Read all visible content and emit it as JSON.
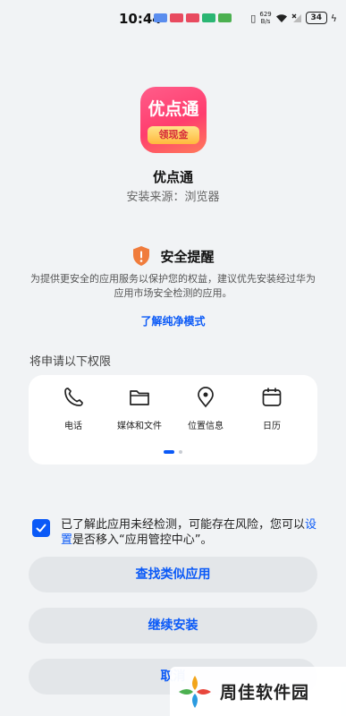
{
  "status_bar": {
    "time": "10:44",
    "net_speed_value": "629",
    "net_speed_unit": "B/s",
    "battery": "34"
  },
  "app": {
    "icon_title": "优点通",
    "icon_ribbon": "领现金",
    "name": "优点通",
    "source": "安装来源：浏览器"
  },
  "security": {
    "title": "安全提醒",
    "body": "为提供更安全的应用服务以保护您的权益，建议优先安装经过华为应用市场安全检测的应用。",
    "link": "了解纯净模式",
    "accent": "#f07c3c"
  },
  "permissions": {
    "heading": "将申请以下权限",
    "items": [
      {
        "label": "电话",
        "icon": "phone-icon"
      },
      {
        "label": "媒体和文件",
        "icon": "folder-icon"
      },
      {
        "label": "位置信息",
        "icon": "location-icon"
      },
      {
        "label": "日历",
        "icon": "calendar-icon"
      }
    ],
    "page_indicator": {
      "current": 1,
      "total": 2
    }
  },
  "consent": {
    "checked": true,
    "text_before": "已了解此应用未经检测，可能存在风险，您可以",
    "link": "设置",
    "text_after": "是否移入“应用管控中心”。"
  },
  "buttons": {
    "similar": "查找类似应用",
    "continue": "继续安装",
    "cancel": "取消"
  },
  "watermark": {
    "text": "周佳软件园"
  },
  "colors": {
    "accent_blue": "#0a59f7",
    "background": "#f1f3f5",
    "button_bg": "#e3e6e9"
  }
}
